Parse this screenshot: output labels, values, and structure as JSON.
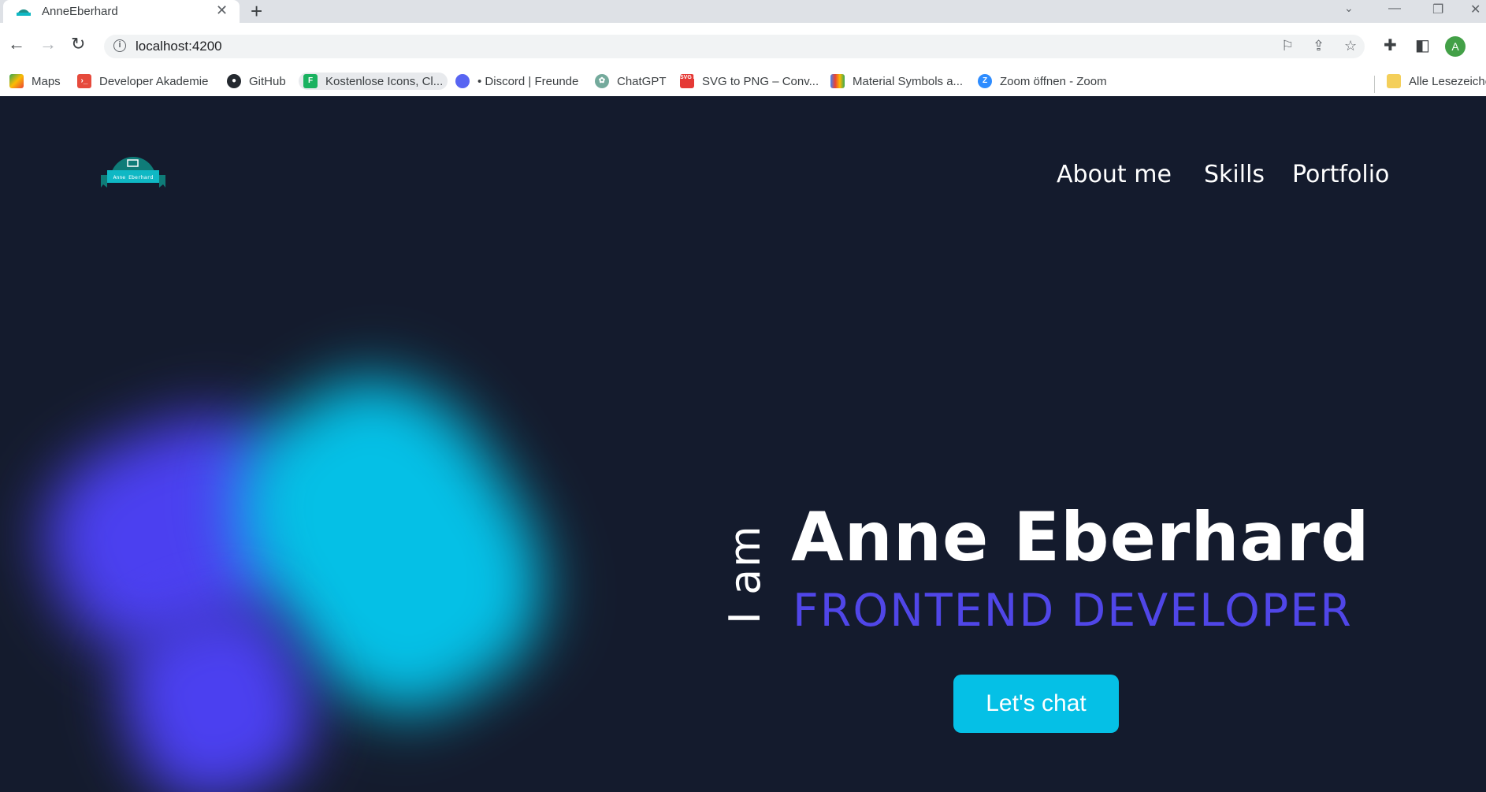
{
  "browser": {
    "tab_title": "AnneEberhard",
    "url": "localhost:4200",
    "profile_initial": "A"
  },
  "bookmarks": [
    {
      "label": "Maps",
      "icon": "maps-icon"
    },
    {
      "label": "Developer Akademie",
      "icon": "developer-akademie-icon"
    },
    {
      "label": "GitHub",
      "icon": "github-icon"
    },
    {
      "label": "Kostenlose Icons, Cl...",
      "icon": "flaticon-icon"
    },
    {
      "label": "• Discord | Freunde",
      "icon": "discord-icon"
    },
    {
      "label": "ChatGPT",
      "icon": "chatgpt-icon"
    },
    {
      "label": "SVG to PNG – Conv...",
      "icon": "svg-png-icon"
    },
    {
      "label": "Material Symbols a...",
      "icon": "material-symbols-icon"
    },
    {
      "label": "Zoom öffnen - Zoom",
      "icon": "zoom-icon"
    },
    {
      "label": "Alle Lesezeiche",
      "icon": "folder-icon"
    }
  ],
  "site": {
    "logo_text": "Anne Eberhard",
    "nav": [
      "About me",
      "Skills",
      "Portfolio"
    ],
    "hero": {
      "intro": "I am",
      "name": "Anne Eberhard",
      "role": "FRONTEND DEVELOPER",
      "cta": "Let's chat"
    }
  },
  "colors": {
    "background": "#141b2d",
    "accent_cyan": "#05c0e6",
    "accent_purple": "#5046e8",
    "logo_teal": "#0f7c78"
  }
}
